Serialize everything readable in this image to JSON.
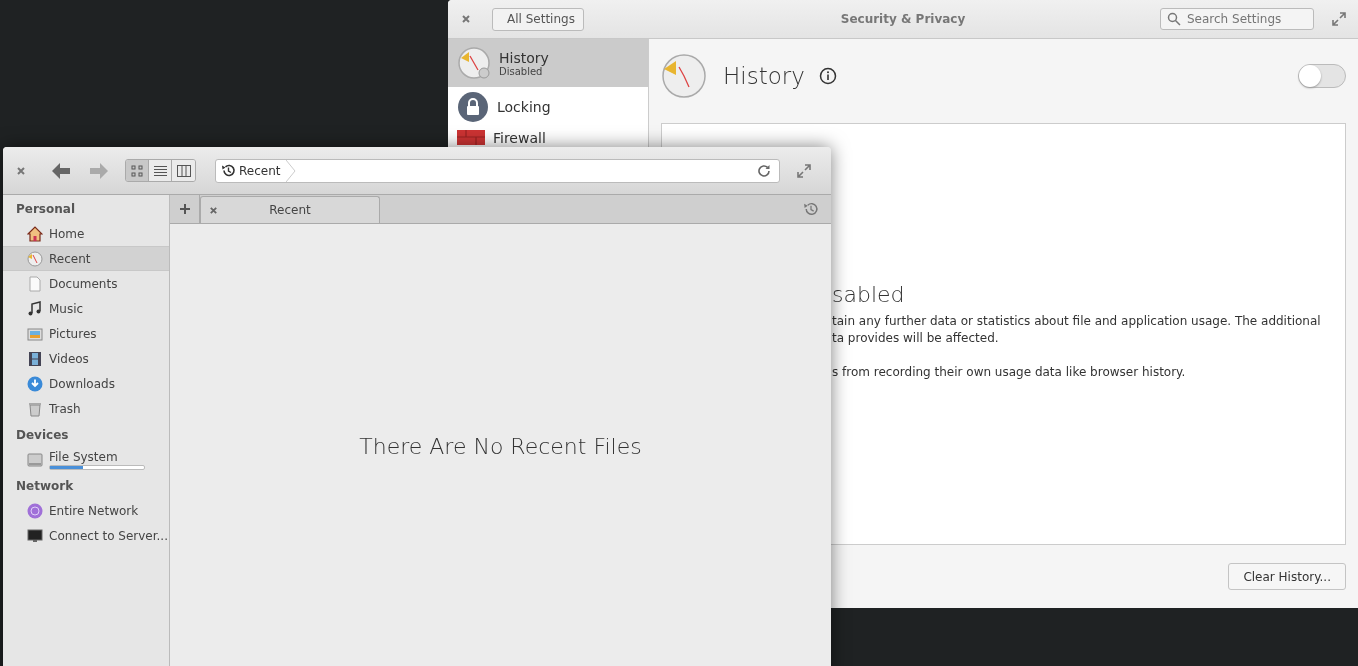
{
  "settings_window": {
    "title": "Security & Privacy",
    "back_button": "All Settings",
    "search": {
      "placeholder": "Search Settings"
    },
    "sidebar": [
      {
        "kind": "history",
        "label": "History",
        "subtitle": "Disabled",
        "selected": true
      },
      {
        "kind": "lock",
        "label": "Locking",
        "selected": false
      },
      {
        "kind": "firewall",
        "label": "Firewall",
        "selected": false
      }
    ],
    "header": {
      "title": "History",
      "on": false
    },
    "panel": {
      "heading": "sabled",
      "lines": [
        "tain any further data or statistics about file and application usage. The additional",
        "ta provides will be affected.",
        "s from recording their own usage data like browser history."
      ]
    },
    "clear_button": "Clear History..."
  },
  "files_window": {
    "view_modes": [
      {
        "kind": "grid",
        "selected": true
      },
      {
        "kind": "list",
        "selected": false
      },
      {
        "kind": "columns",
        "selected": false
      }
    ],
    "path": "Recent",
    "tabs": [
      {
        "label": "Recent",
        "selected": true
      }
    ],
    "sidebar": [
      {
        "heading": "Personal",
        "items": [
          {
            "kind": "home",
            "label": "Home",
            "selected": false
          },
          {
            "kind": "recent",
            "label": "Recent",
            "selected": true
          },
          {
            "kind": "document",
            "label": "Documents",
            "selected": false
          },
          {
            "kind": "music",
            "label": "Music",
            "selected": false
          },
          {
            "kind": "pictures",
            "label": "Pictures",
            "selected": false
          },
          {
            "kind": "videos",
            "label": "Videos",
            "selected": false
          },
          {
            "kind": "downloads",
            "label": "Downloads",
            "selected": false
          },
          {
            "kind": "trash",
            "label": "Trash",
            "selected": false
          }
        ]
      },
      {
        "heading": "Devices",
        "items": [
          {
            "kind": "drive",
            "label": "File System",
            "selected": false,
            "level": 0.35
          }
        ]
      },
      {
        "heading": "Network",
        "items": [
          {
            "kind": "network",
            "label": "Entire Network",
            "selected": false
          },
          {
            "kind": "monitor",
            "label": "Connect to Server...",
            "selected": false
          }
        ]
      }
    ],
    "empty_message": "There Are No Recent Files"
  }
}
